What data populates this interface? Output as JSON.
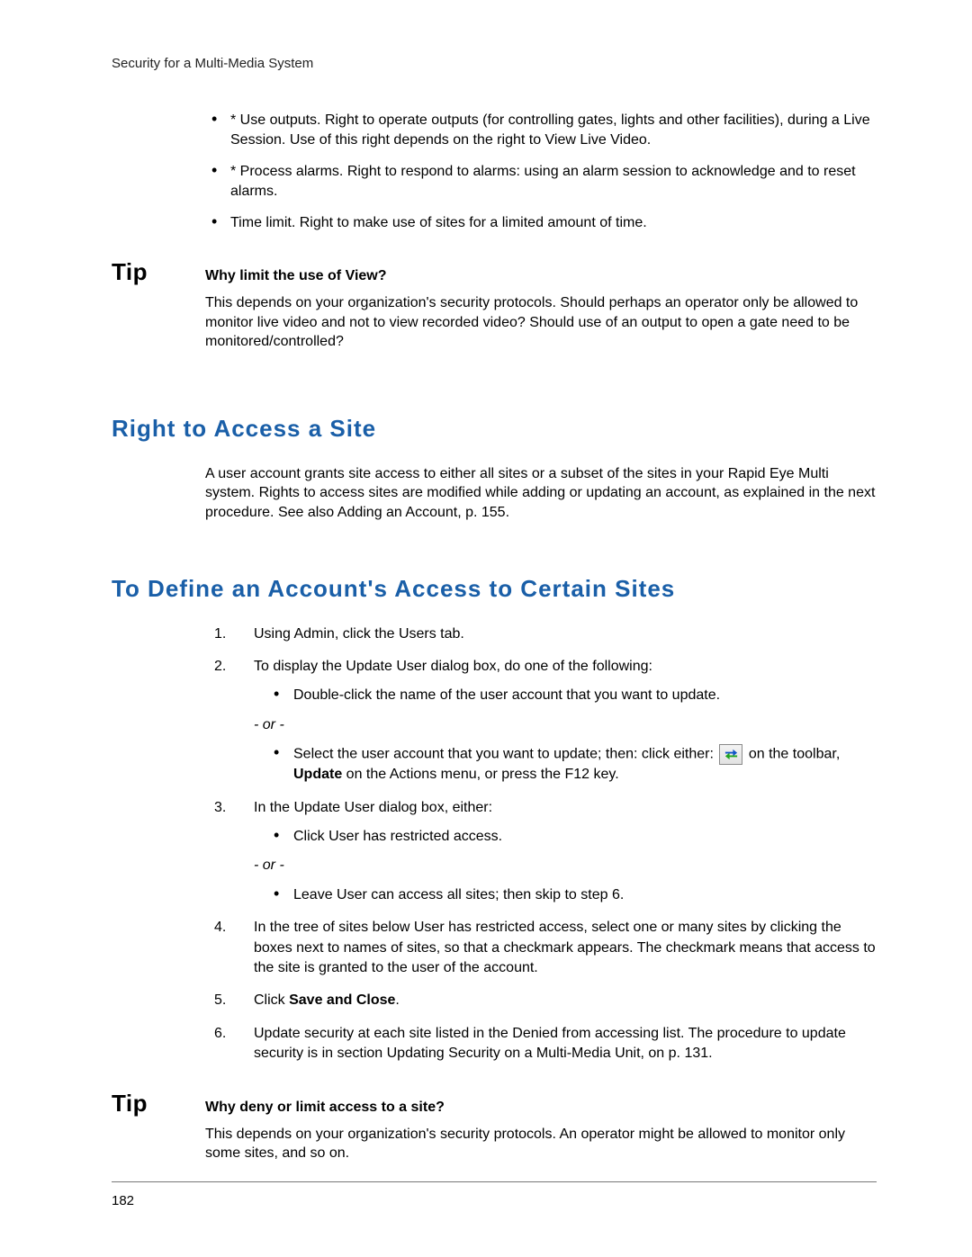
{
  "header": {
    "running_head": "Security for a Multi-Media System"
  },
  "top_bullets": [
    "* Use outputs. Right to operate outputs (for controlling gates, lights and other facilities), during a Live Session. Use of this right depends on the right to View Live Video.",
    "* Process alarms. Right to respond to alarms: using an alarm session to acknowledge and to reset alarms.",
    "Time limit. Right to make use of sites for a limited amount of time."
  ],
  "tip1": {
    "label": "Tip",
    "title": "Why limit the use of View?",
    "body": "This depends on your organization's security protocols. Should perhaps an operator only be allowed to monitor live video and not to view recorded video? Should use of an output to open a gate need to be monitored/controlled?"
  },
  "section1": {
    "heading": "Right to Access a Site",
    "para": "A user account grants site access to either all sites or a subset of the sites in your Rapid Eye Multi system. Rights to access sites are modified while adding or updating an account, as explained in the next procedure. See also Adding an Account, p. 155."
  },
  "section2": {
    "heading": "To Define an Account's Access to Certain Sites",
    "steps": {
      "s1": "Using Admin, click the Users tab.",
      "s2_intro": "To display the Update User dialog box, do one of the following:",
      "s2_a": "Double-click the name of the user account that you want to update.",
      "s2_or": "- or -",
      "s2_b_pre": "Select the user account that you want to update; then: click either: ",
      "s2_b_post": " on the toolbar, ",
      "s2_b_bold": "Update",
      "s2_b_tail": " on the Actions menu, or press the F12 key.",
      "s3_intro": "In the Update User dialog box, either:",
      "s3_a": "Click User has restricted access.",
      "s3_or": "- or -",
      "s3_b": "Leave User can access all sites; then skip to step 6.",
      "s4": "In the tree of sites below User has restricted access, select one or many sites by clicking the boxes next to names of sites, so that a checkmark appears. The checkmark means that access to the site is granted to the user of the account.",
      "s5_pre": "Click ",
      "s5_bold": "Save and Close",
      "s5_post": ".",
      "s6": "Update security at each site listed in the Denied from accessing list. The procedure to update security is in section Updating Security on a Multi-Media Unit, on p. 131."
    }
  },
  "tip2": {
    "label": "Tip",
    "title": "Why deny or limit access to a site?",
    "body": "This depends on your organization's security protocols. An operator might be allowed to monitor only some sites, and so on."
  },
  "footer": {
    "page_num": "182"
  }
}
